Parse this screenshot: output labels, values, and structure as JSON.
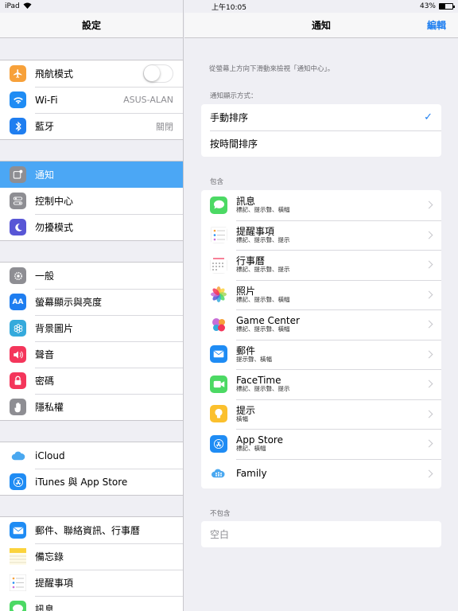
{
  "status": {
    "device": "iPad",
    "time": "上午10:05",
    "battery": "43%",
    "battery_level": 0.43
  },
  "left": {
    "title": "設定",
    "groups": [
      [
        {
          "label": "飛航模式",
          "icon": "airplane-icon",
          "color": "#f7a13a",
          "toggle": false
        },
        {
          "label": "Wi-Fi",
          "icon": "wifi-icon",
          "color": "#1f8cf4",
          "value": "ASUS-ALAN"
        },
        {
          "label": "藍牙",
          "icon": "bluetooth-icon",
          "color": "#1f7ef0",
          "value": "關閉"
        }
      ],
      [
        {
          "label": "通知",
          "icon": "notifications-icon",
          "color": "#8e8e93",
          "selected": true
        },
        {
          "label": "控制中心",
          "icon": "control-center-icon",
          "color": "#8e8e93"
        },
        {
          "label": "勿擾模式",
          "icon": "moon-icon",
          "color": "#5856d6"
        }
      ],
      [
        {
          "label": "一般",
          "icon": "gear-icon",
          "color": "#8e8e93"
        },
        {
          "label": "螢幕顯示與亮度",
          "icon": "display-icon",
          "color": "#1f7ef0"
        },
        {
          "label": "背景圖片",
          "icon": "wallpaper-icon",
          "color": "#35aadc"
        },
        {
          "label": "聲音",
          "icon": "speaker-icon",
          "color": "#f4365b"
        },
        {
          "label": "密碼",
          "icon": "lock-icon",
          "color": "#f4365b"
        },
        {
          "label": "隱私權",
          "icon": "hand-icon",
          "color": "#8e8e93"
        }
      ],
      [
        {
          "label": "iCloud",
          "icon": "cloud-icon",
          "color": "#ffffff"
        },
        {
          "label": "iTunes 與 App Store",
          "icon": "app-store-icon",
          "color": "#1f8cf4"
        }
      ],
      [
        {
          "label": "郵件、聯絡資訊、行事曆",
          "icon": "mail-icon",
          "color": "#1f8cf4"
        },
        {
          "label": "備忘錄",
          "icon": "notes-icon",
          "color": "#fbd33c"
        },
        {
          "label": "提醒事項",
          "icon": "reminders-icon",
          "color": "#ffffff"
        },
        {
          "label": "訊息",
          "icon": "messages-icon",
          "color": "#4cd964"
        }
      ]
    ]
  },
  "right": {
    "title": "通知",
    "edit": "編輯",
    "hint": "從螢幕上方向下滑動來檢視「通知中心」。",
    "sort_label": "通知顯示方式：",
    "sort_options": [
      {
        "label": "手動排序",
        "checked": true
      },
      {
        "label": "按時間排序",
        "checked": false
      }
    ],
    "include_label": "包含",
    "apps": [
      {
        "name": "訊息",
        "sub": "標記、提示聲、橫幅",
        "icon": "messages-icon",
        "color": "#4cd964"
      },
      {
        "name": "提醒事項",
        "sub": "標記、提示聲、提示",
        "icon": "reminders-icon",
        "color": "#ffffff"
      },
      {
        "name": "行事曆",
        "sub": "標記、提示聲、提示",
        "icon": "calendar-icon",
        "color": "#ffffff"
      },
      {
        "name": "照片",
        "sub": "標記、提示聲、橫幅",
        "icon": "photos-icon",
        "color": "#ffffff"
      },
      {
        "name": "Game Center",
        "sub": "標記、提示聲、橫幅",
        "icon": "game-center-icon",
        "color": "#ffffff"
      },
      {
        "name": "郵件",
        "sub": "提示聲、橫幅",
        "icon": "mail-icon",
        "color": "#1f8cf4"
      },
      {
        "name": "FaceTime",
        "sub": "標記、提示聲、提示",
        "icon": "facetime-icon",
        "color": "#4cd964"
      },
      {
        "name": "提示",
        "sub": "橫幅",
        "icon": "tips-icon",
        "color": "#fbc02d"
      },
      {
        "name": "App Store",
        "sub": "標記、橫幅",
        "icon": "app-store-icon",
        "color": "#1f8cf4"
      },
      {
        "name": "Family",
        "sub": "",
        "icon": "family-icon",
        "color": "#ffffff"
      }
    ],
    "exclude_label": "不包含",
    "exclude_empty": "空白"
  }
}
